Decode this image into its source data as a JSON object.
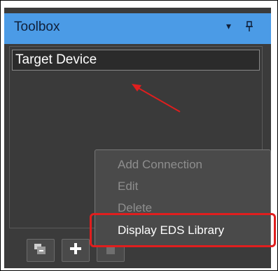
{
  "toolbox": {
    "title": "Toolbox",
    "dropdown_glyph": "▾",
    "pin_glyph": "📌"
  },
  "tree": {
    "items": [
      {
        "label": "Target Device"
      }
    ]
  },
  "context_menu": {
    "items": [
      {
        "label": "Add Connection",
        "enabled": false
      },
      {
        "label": "Edit",
        "enabled": false
      },
      {
        "label": "Delete",
        "enabled": false
      },
      {
        "label": "Display EDS Library",
        "enabled": true
      }
    ]
  },
  "toolbar": {
    "buttons": [
      {
        "icon": "add-folder-icon"
      },
      {
        "icon": "plus-icon"
      },
      {
        "icon": "delete-icon"
      }
    ]
  },
  "colors": {
    "title_bar": "#4b9be6",
    "panel_bg": "#3b3b3b",
    "highlight": "#e01e1e"
  }
}
